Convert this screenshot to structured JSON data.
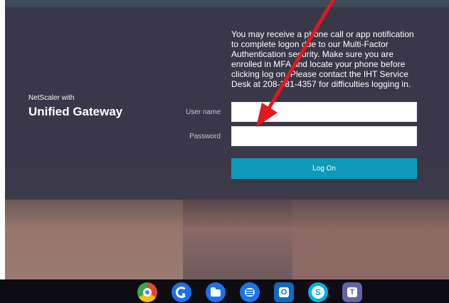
{
  "login": {
    "brand_small": "NetScaler with",
    "brand_large": "Unified Gateway",
    "notice_text": "You may receive a phone call or app notification to complete logon due to our Multi-Factor Authentication security. Make sure you are enrolled in MFA and locate your phone before clicking log on. Please contact the IHT Service Desk at 208-381-4357 for difficulties logging in.",
    "username_label": "User name",
    "password_label": "Password",
    "username_value": "",
    "password_value": "",
    "username_placeholder": "",
    "password_placeholder": "",
    "logon_label": "Log On"
  },
  "colors": {
    "panel": "#3B3849",
    "logon_button": "#0E99BA",
    "annotation_arrow": "#E0191F"
  },
  "taskbar": {
    "icons": [
      {
        "name": "chrome-icon"
      },
      {
        "name": "app-icon"
      },
      {
        "name": "files-icon"
      },
      {
        "name": "messages-icon"
      },
      {
        "name": "outlook-icon"
      },
      {
        "name": "skype-icon"
      },
      {
        "name": "teams-icon"
      }
    ],
    "outlook_letter": "O",
    "skype_letter": "S",
    "teams_letter": "T"
  }
}
